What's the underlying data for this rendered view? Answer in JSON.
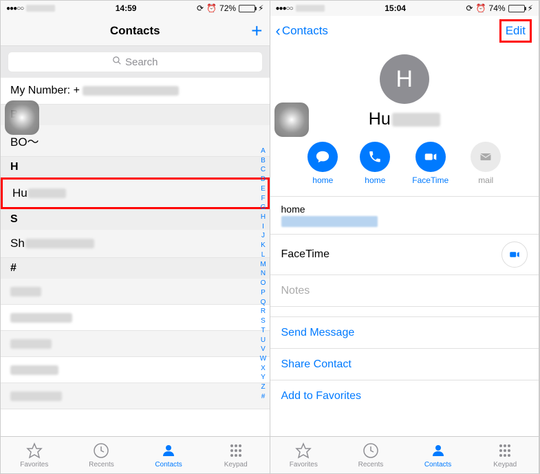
{
  "left": {
    "status": {
      "dots": "●●●○○",
      "time": "14:59",
      "battery_pct": "72%",
      "battery_fill": "72%"
    },
    "navbar": {
      "title": "Contacts",
      "add": "+"
    },
    "search": {
      "placeholder": "Search"
    },
    "my_number_label": "My Number: +",
    "sections": [
      {
        "letter": "B",
        "rows": [
          "BO～"
        ]
      },
      {
        "letter": "H",
        "rows": [
          "Hu"
        ]
      },
      {
        "letter": "S",
        "rows": [
          "Sh"
        ]
      },
      {
        "letter": "#",
        "rows": [
          "",
          "",
          "",
          "",
          ""
        ]
      }
    ],
    "index": [
      "A",
      "B",
      "C",
      "D",
      "E",
      "F",
      "G",
      "H",
      "I",
      "J",
      "K",
      "L",
      "M",
      "N",
      "O",
      "P",
      "Q",
      "R",
      "S",
      "T",
      "U",
      "V",
      "W",
      "X",
      "Y",
      "Z",
      "#"
    ],
    "tabs": {
      "favorites": "Favorites",
      "recents": "Recents",
      "contacts": "Contacts",
      "keypad": "Keypad"
    }
  },
  "right": {
    "status": {
      "dots": "●●●○○",
      "time": "15:04",
      "battery_pct": "74%",
      "battery_fill": "74%"
    },
    "navbar": {
      "back": "Contacts",
      "edit": "Edit"
    },
    "contact": {
      "initial": "H",
      "name": "Hu"
    },
    "actions": {
      "message": "home",
      "call": "home",
      "facetime": "FaceTime",
      "mail": "mail"
    },
    "fields": {
      "phone_label": "home",
      "facetime_label": "FaceTime",
      "notes_label": "Notes"
    },
    "links": {
      "send_message": "Send Message",
      "share_contact": "Share Contact",
      "add_favorites": "Add to Favorites"
    },
    "tabs": {
      "favorites": "Favorites",
      "recents": "Recents",
      "contacts": "Contacts",
      "keypad": "Keypad"
    }
  }
}
